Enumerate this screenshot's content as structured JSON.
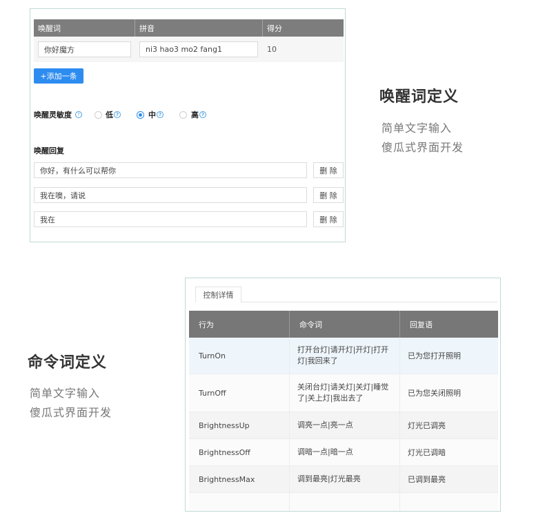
{
  "wake_panel": {
    "columns": [
      "唤醒词",
      "拼音",
      "得分"
    ],
    "row": {
      "word": "你好魔方",
      "pinyin": "ni3 hao3 mo2 fang1",
      "score": "10"
    },
    "add_button": "+添加一条",
    "sensitivity": {
      "label": "唤醒灵敏度",
      "help": "?",
      "options": [
        "低",
        "中",
        "高"
      ],
      "selected": "中"
    },
    "reply": {
      "title": "唤醒回复",
      "items": [
        "你好，有什么可以帮你",
        "我在噢，请说",
        "我在"
      ],
      "delete_label": "删 除"
    }
  },
  "caption_top": {
    "title": "唤醒词定义",
    "line1": "简单文字输入",
    "line2": "傻瓜式界面开发"
  },
  "caption_bottom": {
    "title": "命令词定义",
    "line1": "简单文字输入",
    "line2": "傻瓜式界面开发"
  },
  "command_panel": {
    "tab": "控制详情",
    "columns": [
      "行为",
      "命令词",
      "回复语"
    ],
    "rows": [
      {
        "action": "TurnOn",
        "commands": "打开台灯|请开灯|开灯|打开灯|我回来了",
        "reply": "已为您打开照明"
      },
      {
        "action": "TurnOff",
        "commands": "关闭台灯|请关灯|关灯|睡觉了|关上灯|我出去了",
        "reply": "已为您关闭照明"
      },
      {
        "action": "BrightnessUp",
        "commands": "调亮一点|亮一点",
        "reply": "灯光已调亮"
      },
      {
        "action": "BrightnessOff",
        "commands": "调暗一点|暗一点",
        "reply": "灯光已调暗"
      },
      {
        "action": "BrightnessMax",
        "commands": "调到最亮|灯光最亮",
        "reply": "已调到最亮"
      }
    ]
  },
  "colors": {
    "accent": "#2d8cf0",
    "header_bg": "#7d7d7d",
    "border": "#bfd9d6",
    "row_highlight": "#eef5fb"
  }
}
